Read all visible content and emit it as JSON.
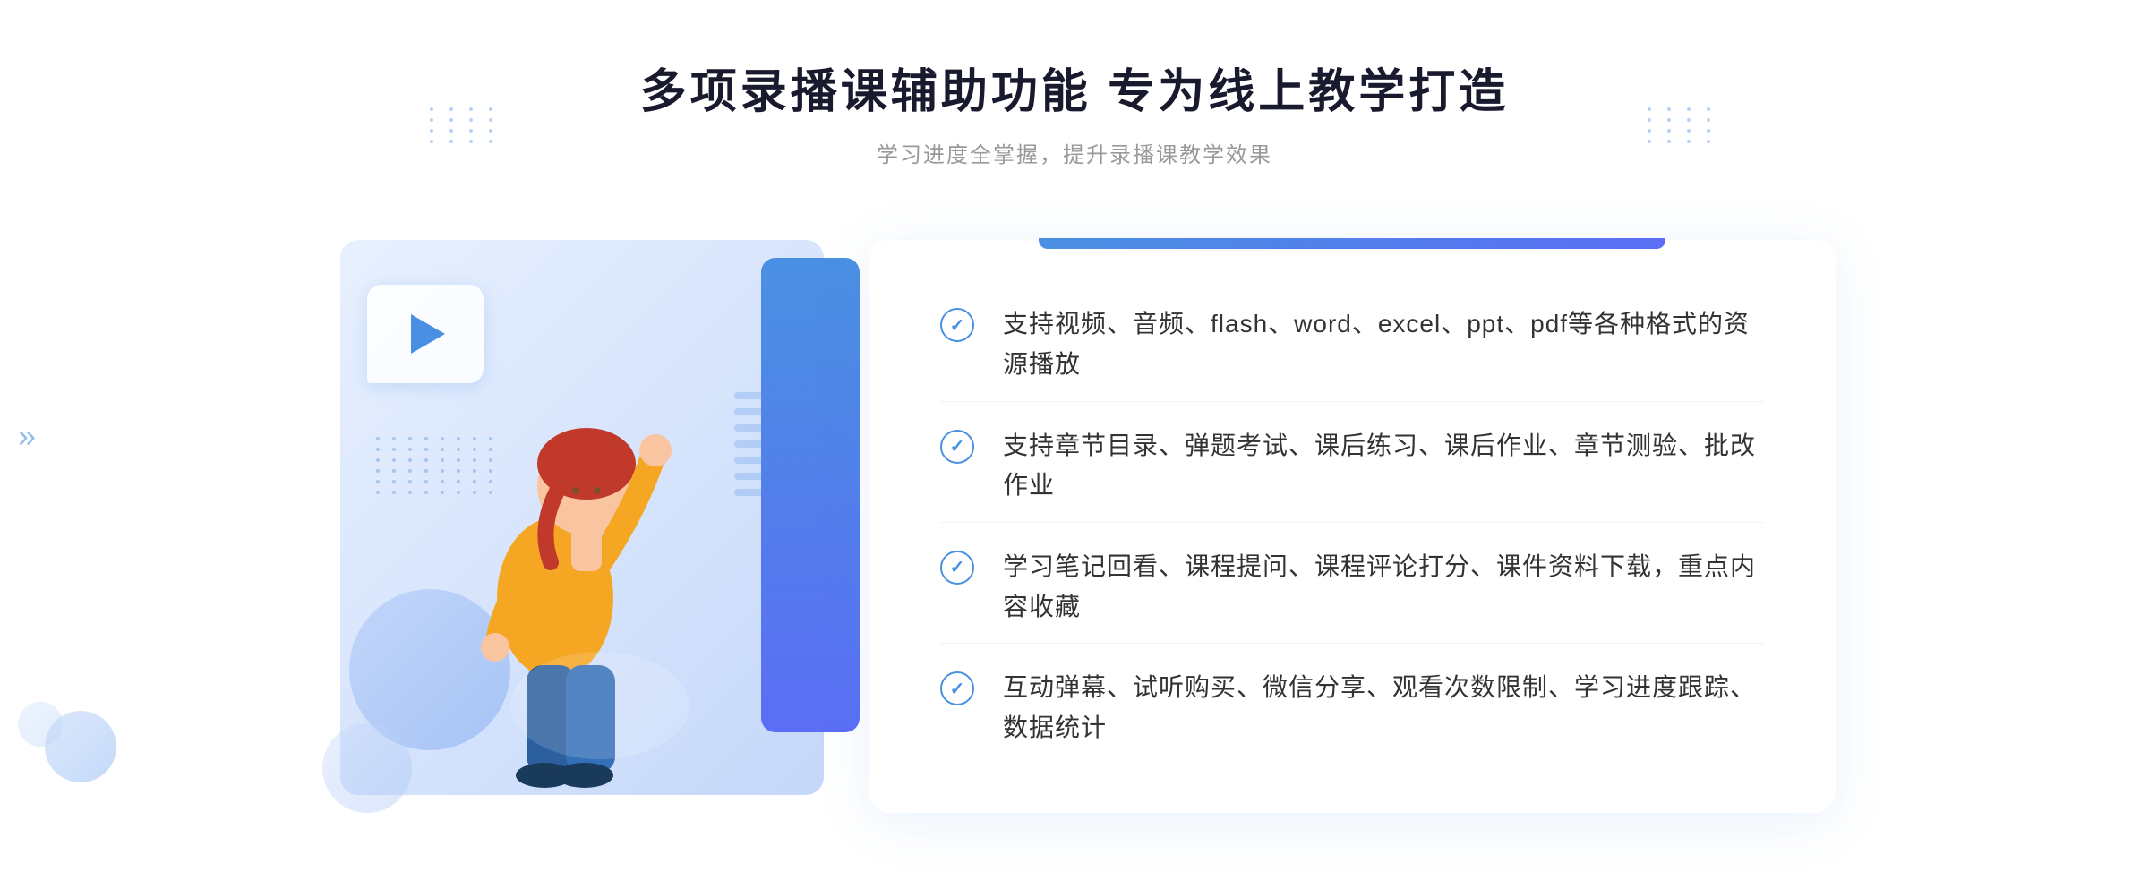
{
  "header": {
    "title": "多项录播课辅助功能 专为线上教学打造",
    "subtitle": "学习进度全掌握，提升录播课教学效果"
  },
  "features": [
    {
      "id": "feature-1",
      "text": "支持视频、音频、flash、word、excel、ppt、pdf等各种格式的资源播放"
    },
    {
      "id": "feature-2",
      "text": "支持章节目录、弹题考试、课后练习、课后作业、章节测验、批改作业"
    },
    {
      "id": "feature-3",
      "text": "学习笔记回看、课程提问、课程评论打分、课件资料下载，重点内容收藏"
    },
    {
      "id": "feature-4",
      "text": "互动弹幕、试听购买、微信分享、观看次数限制、学习进度跟踪、数据统计"
    }
  ],
  "decorations": {
    "arrow_symbol": "»",
    "check_symbol": "✓"
  }
}
